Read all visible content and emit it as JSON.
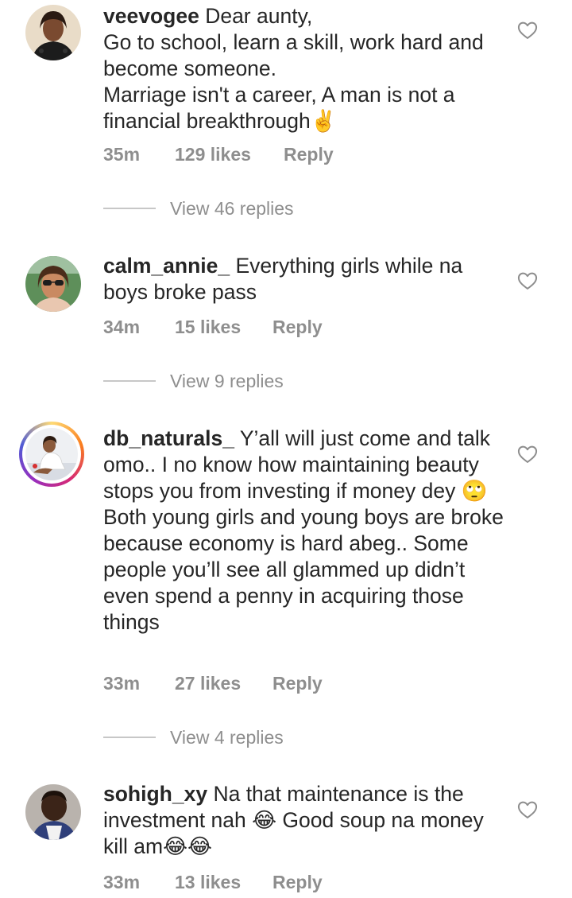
{
  "comments": [
    {
      "username": "veevogee",
      "text": "Dear aunty,\nGo to school, learn a skill, work hard and become someone.\nMarriage isn't a career, A man is not a financial breakthrough✌️",
      "time": "35m",
      "likes": "129 likes",
      "reply_label": "Reply",
      "view_replies": "View 46 replies"
    },
    {
      "username": "calm_annie_",
      "text": "Everything girls while na boys broke pass",
      "time": "34m",
      "likes": "15 likes",
      "reply_label": "Reply",
      "view_replies": "View 9 replies"
    },
    {
      "username": "db_naturals_",
      "text": "Y’all will just come and talk omo.. I no know how maintaining beauty stops you from investing if money dey 🙄\nBoth young girls and young boys are broke because economy is hard abeg.. Some people you’ll see all glammed up didn’t even spend a penny in acquiring those things",
      "time": "33m",
      "likes": "27 likes",
      "reply_label": "Reply",
      "view_replies": "View 4 replies"
    },
    {
      "username": "sohigh_xy",
      "text": "Na that maintenance is the investment nah 😂 Good soup na money kill am😂😂",
      "time": "33m",
      "likes": "13 likes",
      "reply_label": "Reply"
    }
  ],
  "icons": {
    "like": "heart-outline-icon"
  },
  "colors": {
    "text": "#262626",
    "secondary": "#8e8e8e",
    "divider": "#c7c7c7"
  }
}
